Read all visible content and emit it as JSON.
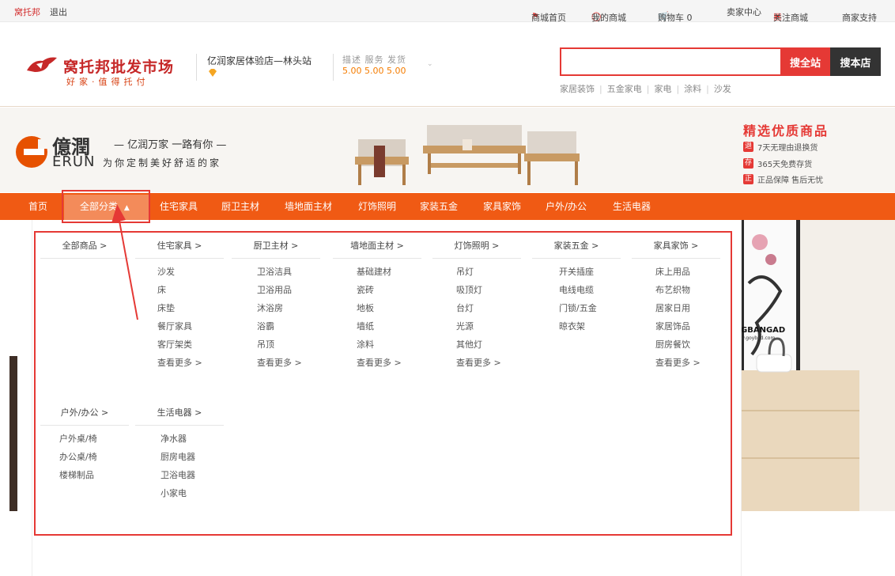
{
  "topbar": {
    "site_name": "窝托邦",
    "logout": "退出",
    "home": "商城首页",
    "my_mall": "我的商城",
    "cart": "购物车 0",
    "seller_center": "卖家中心",
    "follow": "关注商城",
    "support": "商家支持"
  },
  "header": {
    "logo_title": "窝托邦批发市场",
    "logo_sub": "好家·值得托付",
    "store_name": "亿润家居体验店—林头站",
    "score_labels": "描述 服务 发货",
    "score_values": "5.00  5.00  5.00",
    "search_placeholder": "",
    "btn_search_all": "搜全站",
    "btn_search_store": "搜本店",
    "hot_keywords": [
      "家居装饰",
      "五金家电",
      "家电",
      "涂料",
      "沙发"
    ]
  },
  "banner": {
    "brand_cn": "億潤",
    "brand_en": "ERUN",
    "slogan_1": "— 亿润万家 一路有你 —",
    "slogan_2": "为你定制美好舒适的家",
    "promo_title": "精选优质商品",
    "promo_items": [
      {
        "badge": "退",
        "text": "7天无理由退换货"
      },
      {
        "badge": "存",
        "text": "365天免费存货"
      },
      {
        "badge": "正",
        "text": "正品保障 售后无忧"
      }
    ],
    "sticker_text": "GBANGAD",
    "sticker_url": "w.goybad.com"
  },
  "nav": {
    "home": "首页",
    "all_categories": "全部分类",
    "items": [
      "住宅家具",
      "厨卫主材",
      "墙地面主材",
      "灯饰照明",
      "家装五金",
      "家具家饰",
      "户外/办公",
      "生活电器"
    ]
  },
  "dropdown": {
    "row1": [
      {
        "title": "全部商品 >",
        "links": []
      },
      {
        "title": "住宅家具 >",
        "links": [
          "沙发",
          "床",
          "床垫",
          "餐厅家具",
          "客厅架类",
          "查看更多 >"
        ]
      },
      {
        "title": "厨卫主材 >",
        "links": [
          "卫浴洁具",
          "卫浴用品",
          "沐浴房",
          "浴霸",
          "吊顶",
          "查看更多 >"
        ]
      },
      {
        "title": "墙地面主材 >",
        "links": [
          "基础建材",
          "瓷砖",
          "地板",
          "墙纸",
          "涂料",
          "查看更多 >"
        ]
      },
      {
        "title": "灯饰照明 >",
        "links": [
          "吊灯",
          "吸顶灯",
          "台灯",
          "光源",
          "其他灯",
          "查看更多 >"
        ]
      },
      {
        "title": "家装五金 >",
        "links": [
          "开关插座",
          "电线电缆",
          "门锁/五金",
          "晾衣架"
        ]
      },
      {
        "title": "家具家饰 >",
        "links": [
          "床上用品",
          "布艺织物",
          "居家日用",
          "家居饰品",
          "厨房餐饮",
          "查看更多 >"
        ]
      }
    ],
    "row2": [
      {
        "title": "户外/办公 >",
        "links": [
          "户外桌/椅",
          "办公桌/椅",
          "楼梯制品"
        ]
      },
      {
        "title": "生活电器 >",
        "links": [
          "净水器",
          "厨房电器",
          "卫浴电器",
          "小家电"
        ]
      }
    ]
  }
}
